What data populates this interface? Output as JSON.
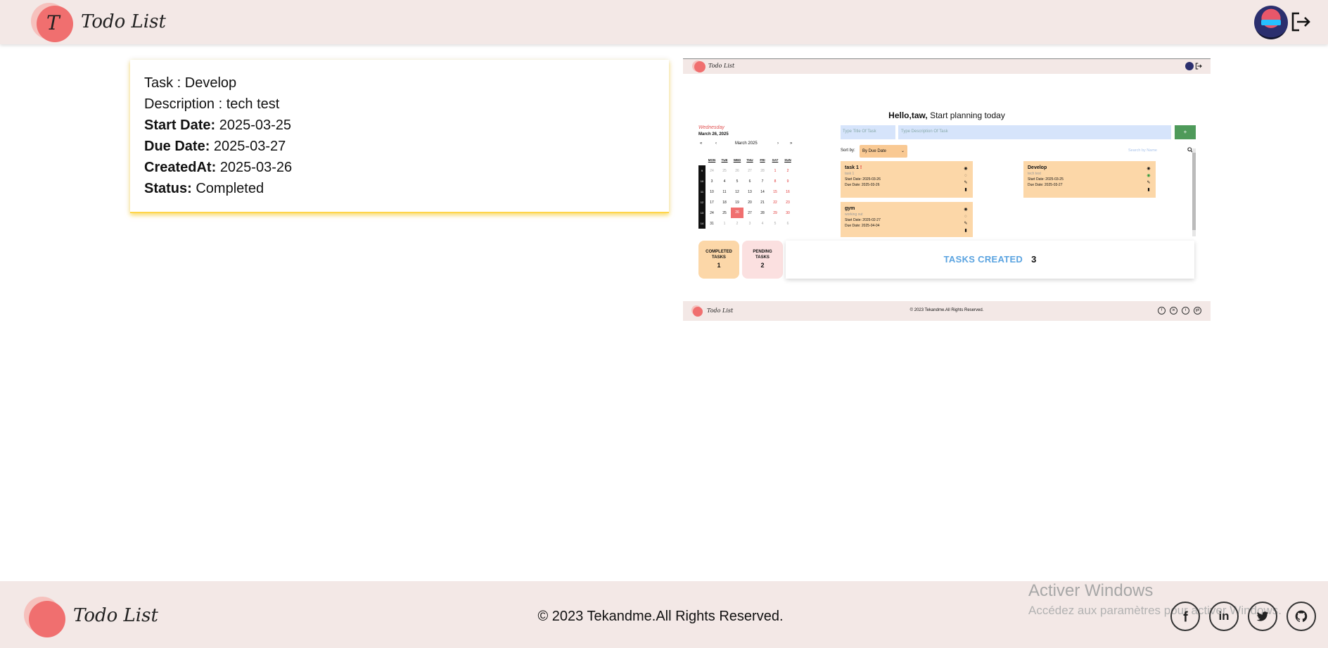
{
  "app": {
    "logo_letter": "T",
    "logo_text": "Todo List"
  },
  "header": {
    "avatar_icon": "user-avatar",
    "logout_icon": "logout-icon"
  },
  "task_detail": {
    "task_label": "Task : ",
    "task_value": "Develop",
    "description_label": "Description : ",
    "description_value": "tech test",
    "start_label": "Start Date:",
    "start_value": "2025-03-25",
    "due_label": "Due Date:",
    "due_value": "2025-03-27",
    "created_label": "CreatedAt:",
    "created_value": "2025-03-26",
    "status_label": "Status:",
    "status_value": "Completed"
  },
  "preview": {
    "logo_text": "Todo List",
    "hello_name": "Hello,taw,",
    "hello_rest": " Start planning today",
    "weekday": "Wednesday",
    "date": "March 26, 2025",
    "calendar": {
      "month": "March 2025",
      "nav": [
        "«",
        "‹",
        "›",
        "»"
      ],
      "headers": [
        "MON",
        "TUE",
        "WED",
        "THU",
        "FRI",
        "SAT",
        "SUN"
      ],
      "weeks": [
        {
          "wk": "9",
          "days": [
            "24",
            "25",
            "26",
            "27",
            "28",
            "1",
            "2"
          ]
        },
        {
          "wk": "10",
          "days": [
            "3",
            "4",
            "5",
            "6",
            "7",
            "8",
            "9"
          ]
        },
        {
          "wk": "11",
          "days": [
            "10",
            "11",
            "12",
            "13",
            "14",
            "15",
            "16"
          ]
        },
        {
          "wk": "12",
          "days": [
            "17",
            "18",
            "19",
            "20",
            "21",
            "22",
            "23"
          ]
        },
        {
          "wk": "13",
          "days": [
            "24",
            "25",
            "26",
            "27",
            "28",
            "29",
            "30"
          ]
        },
        {
          "wk": "14",
          "days": [
            "31",
            "1",
            "2",
            "3",
            "4",
            "5",
            "6"
          ]
        }
      ]
    },
    "title_placeholder": "Type Title Of Task",
    "desc_placeholder": "Type Description Of Task",
    "add_label": "+",
    "sort_label": "Sort by:",
    "sort_value": "By Due Date",
    "search_placeholder": "Search by Name",
    "tasks": [
      {
        "title": "task 1",
        "flag": "!",
        "desc": "task 1",
        "start": "Start Date: 2025-03-26",
        "due": "Due Date: 2025-03-26"
      },
      {
        "title": "Develop",
        "flag": "",
        "desc": "tech test",
        "start": "Start Date: 2025-03-25",
        "due": "Due Date: 2025-03-27"
      },
      {
        "title": "gym",
        "flag": "",
        "desc": "working out",
        "start": "Start Date: 2025-02-27",
        "due": "Due Date: 2025-04-04"
      }
    ],
    "completed_label": "COMPLETED TASKS",
    "completed_count": "1",
    "pending_label": "PENDING TASKS",
    "pending_count": "2",
    "created_label": "TASKS CREATED",
    "created_count": "3",
    "footer_copy": "© 2023 Tekandme.All Rights Reserved.",
    "socials": [
      "f",
      "in",
      "t",
      "gh"
    ]
  },
  "footer": {
    "copyright": "© 2023 Tekandme.All Rights Reserved.",
    "windows_title": "Activer Windows",
    "windows_sub": "Accédez aux paramètres pour activer Windows.",
    "social": [
      {
        "name": "facebook-icon",
        "glyph": "f"
      },
      {
        "name": "linkedin-icon",
        "glyph": "in"
      },
      {
        "name": "twitter-icon",
        "glyph": "t"
      },
      {
        "name": "github-icon",
        "glyph": "gh"
      }
    ]
  },
  "colors": {
    "header_bg": "#f3e8e6",
    "logo_red": "#f06f6f",
    "task_card_shadow": "#ffd54a",
    "task_orange": "#fcd7a8",
    "tasks_created_blue": "#5aa3e0",
    "add_green": "#4e9a5a"
  }
}
